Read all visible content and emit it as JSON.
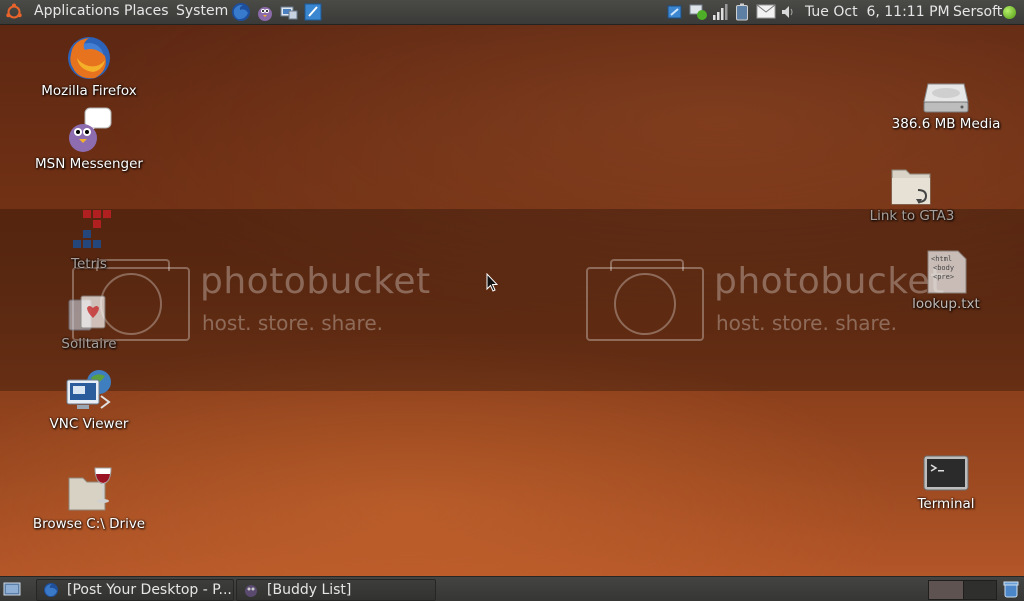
{
  "top_panel": {
    "menus": [
      "Applications",
      "Places",
      "System"
    ],
    "clock": "Tue Oct  6, 11:11 PM",
    "user": "Sersoft"
  },
  "desktop": {
    "icons": [
      {
        "label": "Mozilla Firefox",
        "icon": "firefox-icon"
      },
      {
        "label": "MSN Messenger",
        "icon": "pidgin-icon"
      },
      {
        "label": "Tetris",
        "icon": "tetris-icon"
      },
      {
        "label": "Solitaire",
        "icon": "solitaire-icon"
      },
      {
        "label": "VNC Viewer",
        "icon": "vnc-viewer-icon"
      },
      {
        "label": "Browse C:\\ Drive",
        "icon": "wine-folder-icon"
      },
      {
        "label": "386.6 MB Media",
        "icon": "hard-drive-icon"
      },
      {
        "label": "Link to GTA3",
        "icon": "folder-link-icon"
      },
      {
        "label": "lookup.txt",
        "icon": "text-file-icon",
        "file_preview": [
          "<html",
          "<body",
          "<pre>"
        ]
      },
      {
        "label": "Terminal",
        "icon": "terminal-icon"
      }
    ]
  },
  "watermark": {
    "brand": "photobucket",
    "tagline": "host. store. share."
  },
  "bottom_panel": {
    "tasks": [
      {
        "label": "[Post Your Desktop - P...",
        "icon": "firefox-icon"
      },
      {
        "label": "[Buddy List]",
        "icon": "pidgin-icon"
      }
    ]
  },
  "colors": {
    "panel": "#3a3a38",
    "desktop_dark": "#5a2612",
    "desktop_light": "#b9592a",
    "status_online": "#4f9a12"
  }
}
